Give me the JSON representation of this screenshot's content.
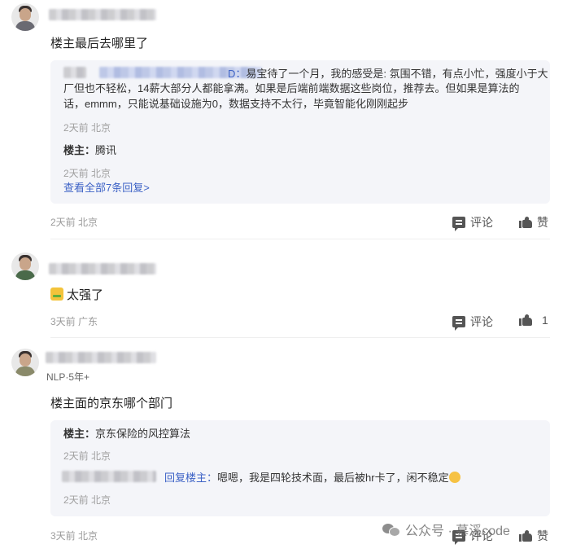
{
  "comments": [
    {
      "text": "楼主最后去哪里了",
      "replies": [
        {
          "suffix": "D：",
          "content_l1": "易宝待了一个月，我的感受是: 氛围不错，有点小忙，强度小于大",
          "content_l2": "厂但也不轻松，14薪大部分人都能拿满。如果是后端前端数据这些岗位，推荐去。但如果是算法的",
          "content_l3": "话，emmm，只能说基础设施为0，数据支持不太行，毕竟智能化刚刚起步",
          "meta": "2天前 北京"
        },
        {
          "author": "楼主：",
          "content": "腾讯",
          "meta": "2天前 北京"
        }
      ],
      "view_all": "查看全部7条回复>",
      "meta": "2天前 北京",
      "comment_label": "评论",
      "like_label": "赞"
    },
    {
      "text": "太强了",
      "meta": "3天前 广东",
      "comment_label": "评论",
      "like_count": "1"
    },
    {
      "subtitle": "NLP·5年+",
      "text": "楼主面的京东哪个部门",
      "replies": [
        {
          "author": "楼主：",
          "content": "京东保险的风控算法",
          "meta": "2天前 北京"
        },
        {
          "reply_to": "回复楼主：",
          "content": "嗯嗯，我是四轮技术面，最后被hr卡了，闲不稳定",
          "meta": "2天前 北京"
        }
      ],
      "meta": "3天前 北京",
      "comment_label": "评论",
      "like_label": "赞"
    }
  ],
  "watermark": {
    "text": "公众号 · 慕溪code"
  },
  "icons": {
    "comment": "comment-icon",
    "like": "thumbs-up-icon",
    "wechat": "wechat-icon"
  },
  "colors": {
    "link": "#3e63c6",
    "reply_bg": "#f4f5f9",
    "meta": "#9a9a9a"
  }
}
